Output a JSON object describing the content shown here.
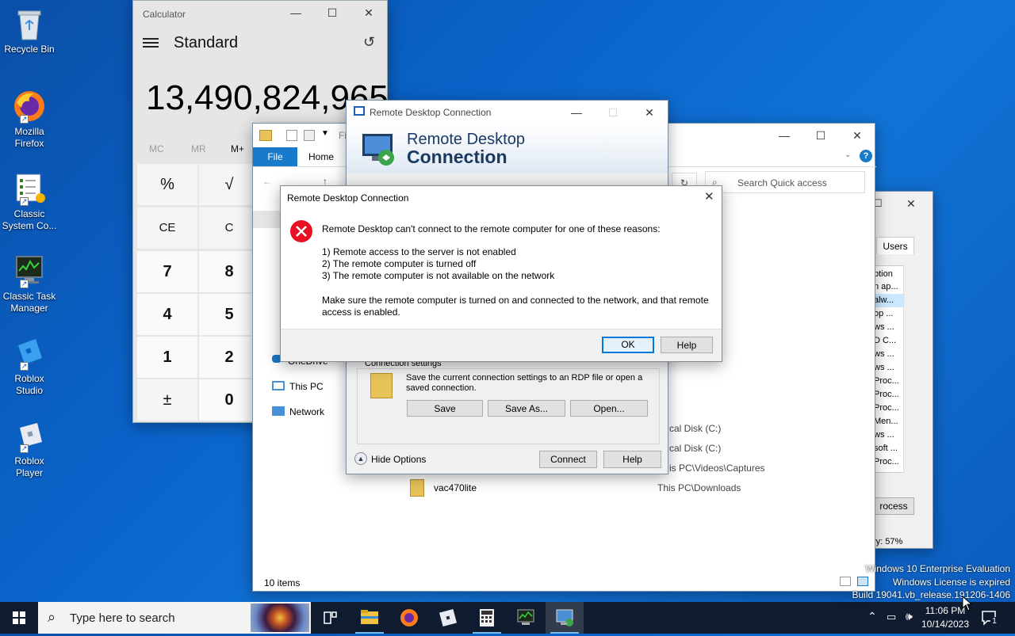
{
  "desktop": {
    "icons": [
      {
        "label": "Recycle Bin"
      },
      {
        "label": "Mozilla Firefox"
      },
      {
        "label": "Classic System Co..."
      },
      {
        "label": "Classic Task Manager"
      },
      {
        "label": "Roblox Studio"
      },
      {
        "label": "Roblox Player"
      }
    ],
    "watermark": {
      "line1": "Windows 10 Enterprise Evaluation",
      "line2": "Windows License is expired",
      "line3": "Build 19041.vb_release.191206-1406"
    }
  },
  "calculator": {
    "title": "Calculator",
    "mode": "Standard",
    "display": "13,490,824,965",
    "memory": [
      "MC",
      "MR",
      "M+"
    ],
    "keys": [
      "%",
      "√",
      "CE",
      "C",
      "7",
      "8",
      "4",
      "5",
      "1",
      "2",
      "±",
      "0"
    ]
  },
  "explorer": {
    "ribbon_file": "File",
    "ribbon_home": "Home",
    "title_frag": "Fi",
    "search_placeholder": "Search Quick access",
    "nav": {
      "onedrive": "OneDrive",
      "thispc": "This PC",
      "network": "Network"
    },
    "rows": [
      {
        "location": "cal Disk (C:)"
      },
      {
        "location": "cal Disk (C:)"
      },
      {
        "location": "is PC\\Videos\\Captures"
      },
      {
        "name": "vac470lite",
        "location": "This PC\\Downloads"
      }
    ],
    "status": "10 items"
  },
  "taskmanager": {
    "tab": "Users",
    "col": "ption",
    "items": [
      "n ap...",
      "alw...",
      "op ...",
      "ws ...",
      "D C...",
      "ws ...",
      "ws ...",
      "Proc...",
      "Proc...",
      "Proc...",
      "Men...",
      "ws ...",
      "soft ...",
      "Proc..."
    ],
    "button": "rocess",
    "status": "ry: 57%"
  },
  "rdc": {
    "title": "Remote Desktop Connection",
    "banner1": "Remote Desktop",
    "banner2": "Connection",
    "section": "Connection settings",
    "desc": "Save the current connection settings to an RDP file or open a saved connection.",
    "save": "Save",
    "saveas": "Save As...",
    "open": "Open...",
    "hide": "Hide Options",
    "connect": "Connect",
    "help": "Help"
  },
  "dialog": {
    "title": "Remote Desktop Connection",
    "message": "Remote Desktop can't connect to the remote computer for one of these reasons:",
    "reasons": [
      "1) Remote access to the server is not enabled",
      "2) The remote computer is turned off",
      "3) The remote computer is not available on the network"
    ],
    "advice1": "Make sure the remote computer is turned on and connected to the network, and that remote",
    "advice2": "access is enabled.",
    "ok": "OK",
    "help": "Help"
  },
  "taskbar": {
    "search_placeholder": "Type here to search",
    "time": "11:06 PM",
    "date": "10/14/2023",
    "notifications": "1"
  }
}
